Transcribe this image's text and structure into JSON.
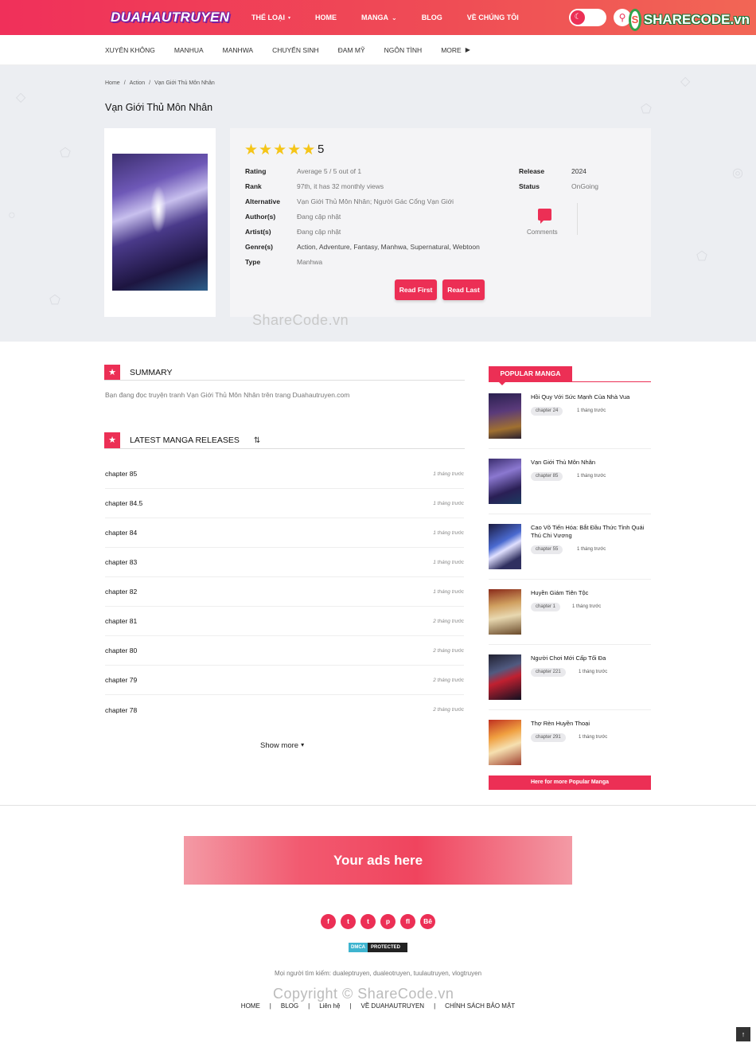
{
  "header": {
    "logo": "DUAHAUTRUYEN",
    "nav": [
      "THỂ LOẠI",
      "HOME",
      "MANGA",
      "BLOG",
      "VỀ CHÚNG TÔI"
    ],
    "sharecode_logo": "SHARECODE.vn"
  },
  "subnav": [
    "XUYÊN KHÔNG",
    "MANHUA",
    "MANHWA",
    "CHUYỂN SINH",
    "ĐAM MỸ",
    "NGÔN TÌNH",
    "MORE"
  ],
  "breadcrumb": [
    "Home",
    "Action",
    "Vạn Giới Thủ Môn Nhân"
  ],
  "manga": {
    "title": "Vạn Giới Thủ Môn Nhân",
    "score": "5",
    "star_rating": 5,
    "info": [
      {
        "label": "Rating",
        "value": "Average 5 / 5 out of 1"
      },
      {
        "label": "Rank",
        "value": "97th, it has 32 monthly views"
      },
      {
        "label": "Alternative",
        "value": "Vạn Giới Thủ Môn Nhân; Người Gác Cổng Vạn Giới"
      },
      {
        "label": "Author(s)",
        "value": "Đang cập nhật"
      },
      {
        "label": "Artist(s)",
        "value": "Đang cập nhật"
      },
      {
        "label": "Genre(s)",
        "value": "Action,  Adventure,  Fantasy,  Manhwa,  Supernatural,  Webtoon"
      },
      {
        "label": "Type",
        "value": "Manhwa"
      }
    ],
    "release_label": "Release",
    "release": "2024",
    "status_label": "Status",
    "status": "OnGoing",
    "comments_label": "Comments",
    "read_first": "Read First",
    "read_last": "Read Last"
  },
  "watermark": "ShareCode.vn",
  "summary": {
    "title": "SUMMARY",
    "text": "Bạn đang đọc truyện tranh Vạn Giới Thủ Môn Nhân trên trang Duahautruyen.com"
  },
  "releases": {
    "title": "LATEST MANGA RELEASES",
    "chapters": [
      {
        "name": "chapter 85",
        "time": "1 tháng trước"
      },
      {
        "name": "chapter 84.5",
        "time": "1 tháng trước"
      },
      {
        "name": "chapter 84",
        "time": "1 tháng trước"
      },
      {
        "name": "chapter 83",
        "time": "1 tháng trước"
      },
      {
        "name": "chapter 82",
        "time": "1 tháng trước"
      },
      {
        "name": "chapter 81",
        "time": "2 tháng trước"
      },
      {
        "name": "chapter 80",
        "time": "2 tháng trước"
      },
      {
        "name": "chapter 79",
        "time": "2 tháng trước"
      },
      {
        "name": "chapter 78",
        "time": "2 tháng trước"
      }
    ],
    "show_more": "Show more"
  },
  "popular": {
    "title": "POPULAR MANGA",
    "items": [
      {
        "name": "Hồi Quy Với Sức Mạnh Của Nhà Vua",
        "chapter": "chapter 24",
        "time": "1 tháng trước"
      },
      {
        "name": "Vạn Giới Thủ Môn Nhân",
        "chapter": "chapter 85",
        "time": "1 tháng trước"
      },
      {
        "name": "Cao Võ Tiến Hóa: Bắt Đầu Thức Tỉnh Quái Thú Chi Vương",
        "chapter": "chapter 55",
        "time": "1 tháng trước"
      },
      {
        "name": "Huyền Giám Tiên Tộc",
        "chapter": "chapter 1",
        "time": "1 tháng trước"
      },
      {
        "name": "Người Chơi Mới Cấp Tối Đa",
        "chapter": "chapter 221",
        "time": "1 tháng trước"
      },
      {
        "name": "Thợ Rèn Huyền Thoại",
        "chapter": "chapter 291",
        "time": "1 tháng trước"
      }
    ],
    "more": "Here for more Popular Manga"
  },
  "ads": "Your ads here",
  "social": [
    "f",
    "t",
    "t",
    "p",
    "fl",
    "Bē"
  ],
  "dmca": {
    "a": "DMCA",
    "b": "PROTECTED"
  },
  "footer": {
    "search_text": "Mọi người tìm kiếm: dualeptruyen, dualeotruyen, tuulautruyen, vlogtruyen",
    "copyright": "Copyright © ShareCode.vn",
    "links": [
      "HOME",
      "BLOG",
      "Liên hệ",
      "VỀ DUAHAUTRUYEN",
      "CHÍNH SÁCH BẢO MẬT"
    ]
  }
}
